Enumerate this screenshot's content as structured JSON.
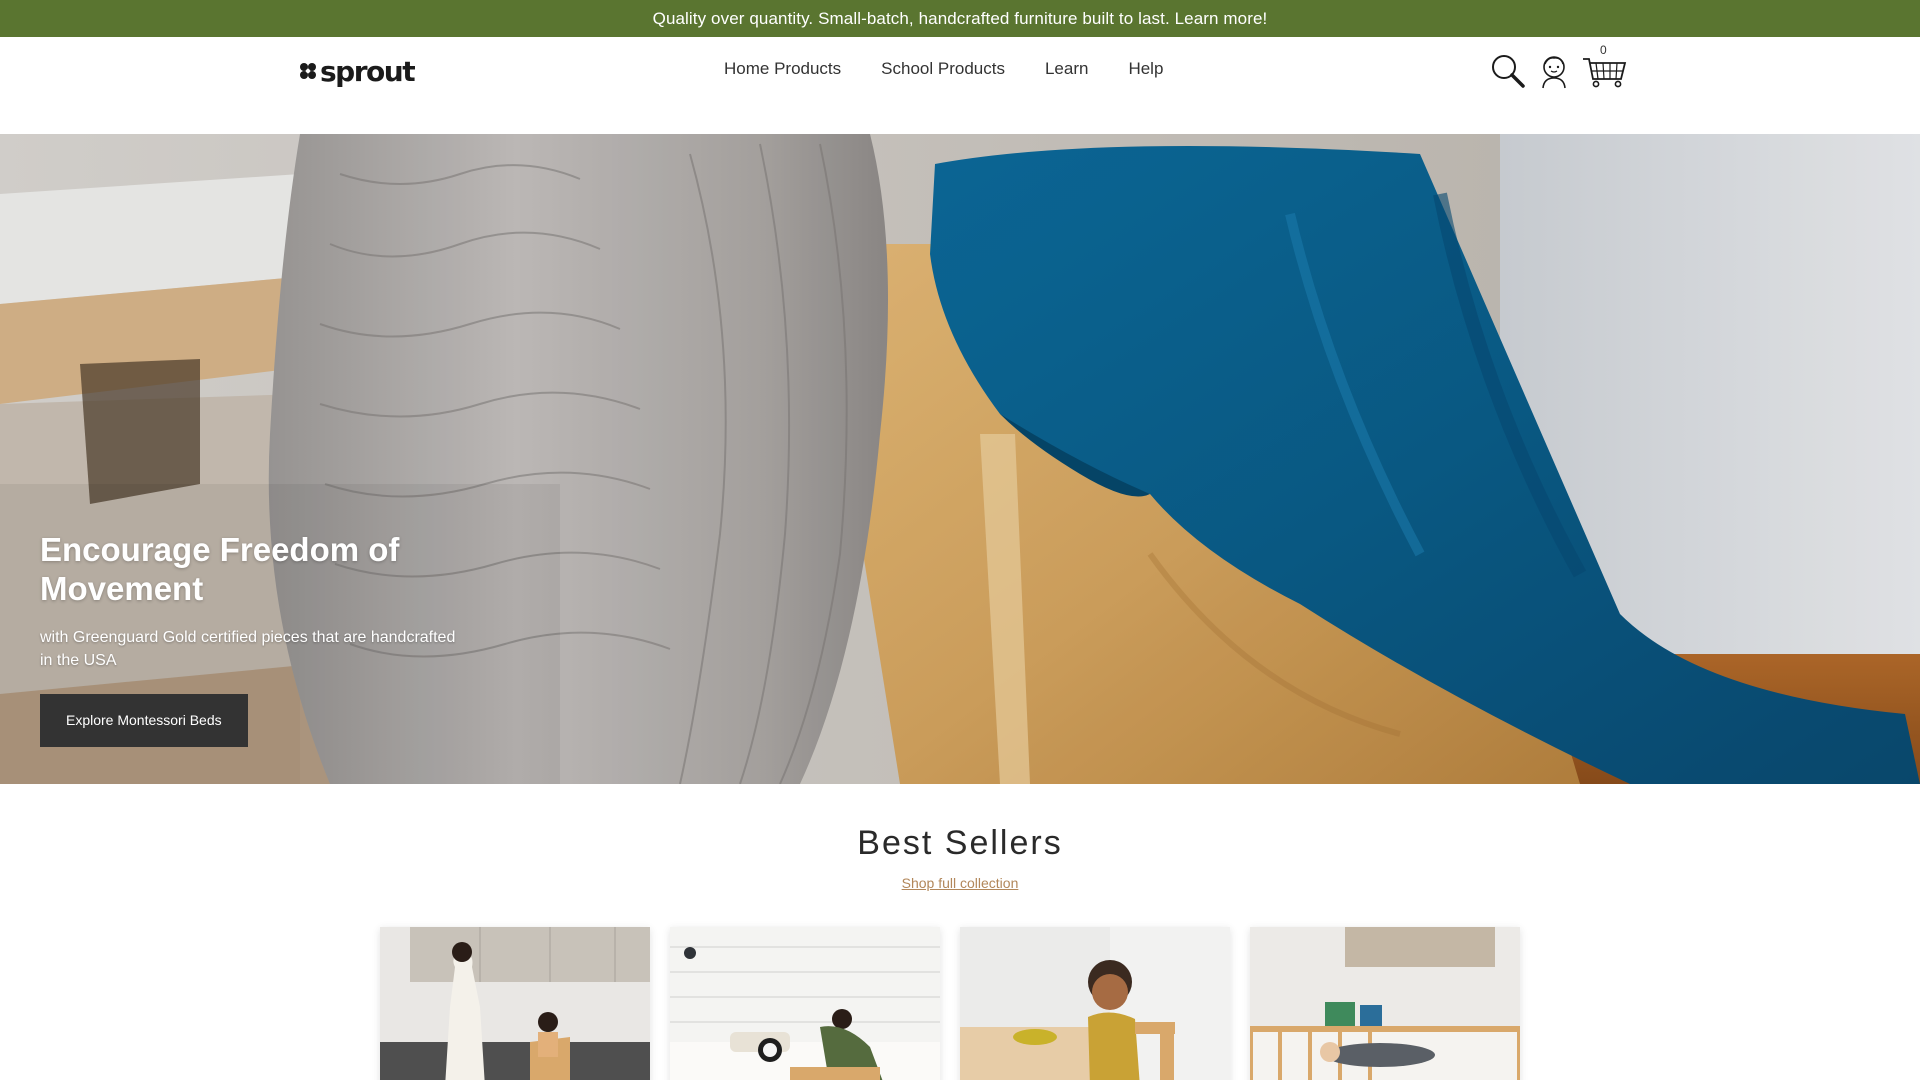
{
  "announcement": {
    "text": "Quality over quantity. Small-batch, handcrafted furniture built to last. Learn more!"
  },
  "header": {
    "logo_text": "sprout",
    "nav": [
      "Home Products",
      "School Products",
      "Learn",
      "Help"
    ],
    "cart_count": "0",
    "icons": [
      "search-icon",
      "account-icon",
      "cart-icon"
    ]
  },
  "hero": {
    "title": "Encourage Freedom of Movement",
    "subtitle": "with Greenguard Gold certified pieces that are handcrafted in the USA",
    "button_label": "Explore Montessori Beds"
  },
  "best_sellers": {
    "title": "Best Sellers",
    "link_label": "Shop full collection"
  },
  "colors": {
    "announcement_bg": "#5a7530",
    "button_bg": "#333333",
    "link": "#b2875a"
  }
}
